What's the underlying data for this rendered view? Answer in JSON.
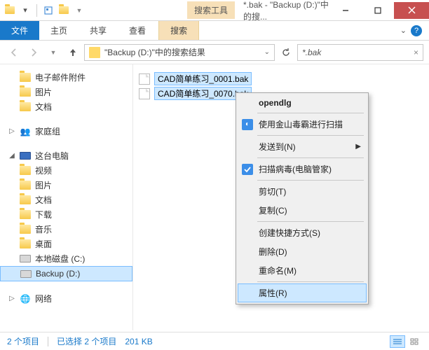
{
  "title": {
    "tool_tab": "搜索工具",
    "text": "*.bak - \"Backup (D:)\"中的搜..."
  },
  "ribbon": {
    "file": "文件",
    "tabs": [
      "主页",
      "共享",
      "查看"
    ],
    "search_tab": "搜索"
  },
  "nav": {
    "address": "\"Backup (D:)\"中的搜索结果",
    "search_value": "*.bak"
  },
  "sidebar": {
    "fav": {
      "items": [
        "电子邮件附件",
        "图片",
        "文档"
      ]
    },
    "homegroup": "家庭组",
    "thispc": {
      "label": "这台电脑",
      "items": [
        "视频",
        "图片",
        "文档",
        "下载",
        "音乐",
        "桌面",
        "本地磁盘 (C:)",
        "Backup (D:)"
      ]
    },
    "network": "网络"
  },
  "files": [
    "CAD简单练习_0001.bak",
    "CAD简单练习_0070.bak"
  ],
  "ctx": {
    "open": "opendlg",
    "scan1": "使用金山毒霸进行扫描",
    "sendto": "发送到(N)",
    "scan2": "扫描病毒(电脑管家)",
    "cut": "剪切(T)",
    "copy": "复制(C)",
    "shortcut": "创建快捷方式(S)",
    "delete": "删除(D)",
    "rename": "重命名(M)",
    "props": "属性(R)"
  },
  "status": {
    "items": "2 个项目",
    "selected": "已选择 2 个项目",
    "size": "201 KB"
  }
}
